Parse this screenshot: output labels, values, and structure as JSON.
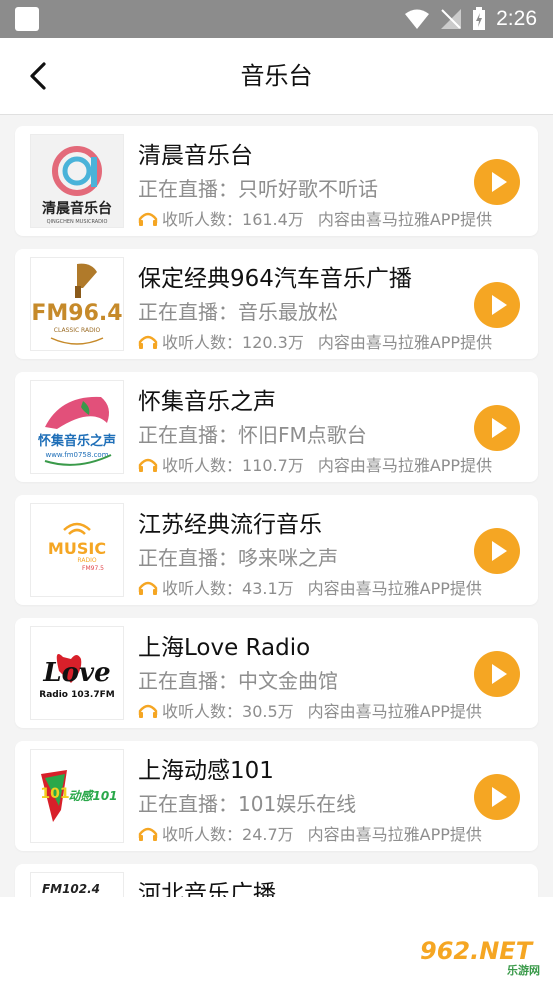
{
  "status_bar": {
    "time": "2:26"
  },
  "header": {
    "title": "音乐台"
  },
  "live_prefix": "正在直播：",
  "listeners_prefix": "收听人数：",
  "source_note": "内容由喜马拉雅APP提供",
  "accent_color": "#f5a623",
  "stations": [
    {
      "name": "清晨音乐台",
      "now_playing": "只听好歌不听话",
      "listeners": "161.4万",
      "logo": {
        "line1": "清晨音乐台",
        "line2": "QINGCHEN MUSICRADIO"
      }
    },
    {
      "name": "保定经典964汽车音乐广播",
      "now_playing": "音乐最放松",
      "listeners": "120.3万",
      "logo": {
        "line1": "FM96.4",
        "line2": "CLASSIC RADIO"
      }
    },
    {
      "name": "怀集音乐之声",
      "now_playing": "怀旧FM点歌台",
      "listeners": "110.7万",
      "logo": {
        "line1": "怀集音乐之声",
        "line2": "www.fm0758.com"
      }
    },
    {
      "name": "江苏经典流行音乐",
      "now_playing": "哆来咪之声",
      "listeners": "43.1万",
      "logo": {
        "line1": "MUSIC",
        "line2": "RADIO",
        "line3": "FM97.5"
      }
    },
    {
      "name": "上海Love Radio",
      "now_playing": "中文金曲馆",
      "listeners": "30.5万",
      "logo": {
        "line1": "Love",
        "line2": "Radio 103.7FM"
      }
    },
    {
      "name": "上海动感101",
      "now_playing": "101娱乐在线",
      "listeners": "24.7万",
      "logo": {
        "line1": "101",
        "line2": "动感101"
      }
    },
    {
      "name": "河北音乐广播",
      "logo": {
        "line1": "FM102.4"
      }
    }
  ],
  "watermark": {
    "text": "962.NET",
    "sub": "乐游网"
  }
}
